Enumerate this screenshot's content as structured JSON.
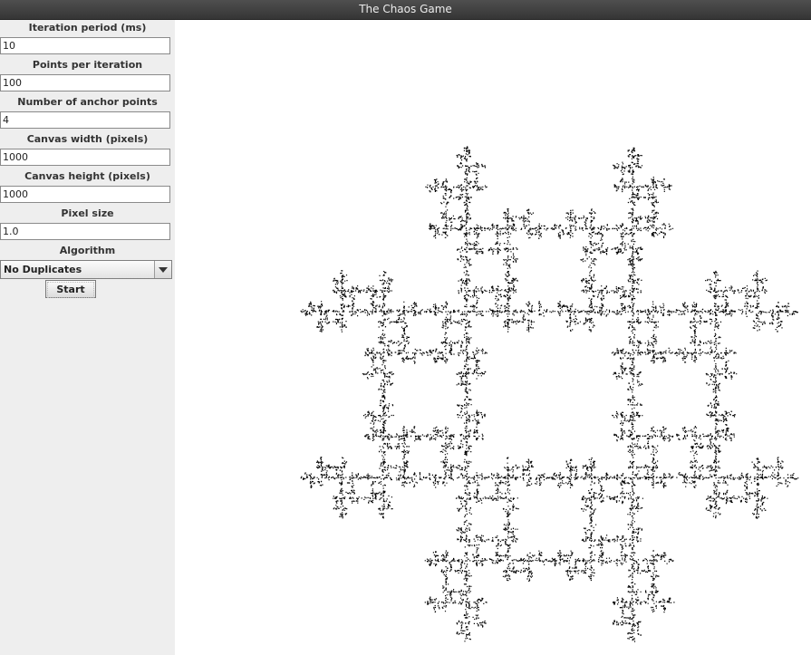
{
  "window": {
    "title": "The Chaos Game"
  },
  "controls": {
    "iteration_period": {
      "label": "Iteration period (ms)",
      "value": "10"
    },
    "points_per_iteration": {
      "label": "Points per iteration",
      "value": "100"
    },
    "anchor_points": {
      "label": "Number of anchor points",
      "value": "4"
    },
    "canvas_width": {
      "label": "Canvas width (pixels)",
      "value": "1000"
    },
    "canvas_height": {
      "label": "Canvas height (pixels)",
      "value": "1000"
    },
    "pixel_size": {
      "label": "Pixel size",
      "value": "1.0"
    },
    "algorithm": {
      "label": "Algorithm",
      "selected": "No Duplicates"
    },
    "start_label": "Start"
  },
  "canvas": {
    "point_color": "#000000",
    "background_color": "#ffffff"
  },
  "icons": {
    "dropdown": "chevron-down-icon"
  }
}
